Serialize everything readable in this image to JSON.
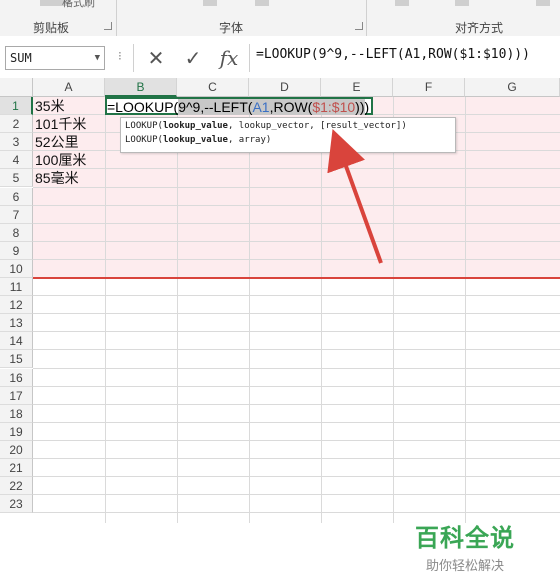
{
  "ribbon": {
    "clipboard_label": "剪贴板",
    "font_label": "字体",
    "alignment_label": "对齐方式",
    "format_painter_label": "格式刷"
  },
  "formula_bar": {
    "name_box": "SUM",
    "formula": "=LOOKUP(9^9,--LEFT(A1,ROW($1:$10)))"
  },
  "columns": [
    "A",
    "B",
    "C",
    "D",
    "E",
    "F",
    "G"
  ],
  "rows": [
    "1",
    "2",
    "3",
    "4",
    "5",
    "6",
    "7",
    "8",
    "9",
    "10",
    "11",
    "12",
    "13",
    "14",
    "15",
    "16",
    "17",
    "18",
    "19",
    "20",
    "21",
    "22",
    "23"
  ],
  "cells": [
    {
      "ref": "A1",
      "value": "35米"
    },
    {
      "ref": "A2",
      "value": "101千米"
    },
    {
      "ref": "A3",
      "value": "52公里"
    },
    {
      "ref": "A4",
      "value": "100厘米"
    },
    {
      "ref": "A5",
      "value": "85毫米"
    }
  ],
  "editing_cell": {
    "ref": "B1",
    "part1": "=LOOKUP(",
    "part2": "9^9,--LEFT(",
    "ref_a1": "A1",
    "part3": ",ROW(",
    "ref_rows": "$1:$10",
    "part4": "))",
    "part5": ")"
  },
  "tooltip": {
    "line1_fn": "LOOKUP(",
    "line1_arg1": "lookup_value",
    "line1_rest": ", lookup_vector, [result_vector])",
    "line2_fn": "LOOKUP(",
    "line2_arg1": "lookup_value",
    "line2_rest": ", array)"
  },
  "watermark": {
    "title": "百科全说",
    "subtitle": "助你轻松解决"
  },
  "colors": {
    "accent": "#217346",
    "highlight": "#fdecee",
    "annotation": "#d9443c",
    "watermark": "#3aa655"
  }
}
